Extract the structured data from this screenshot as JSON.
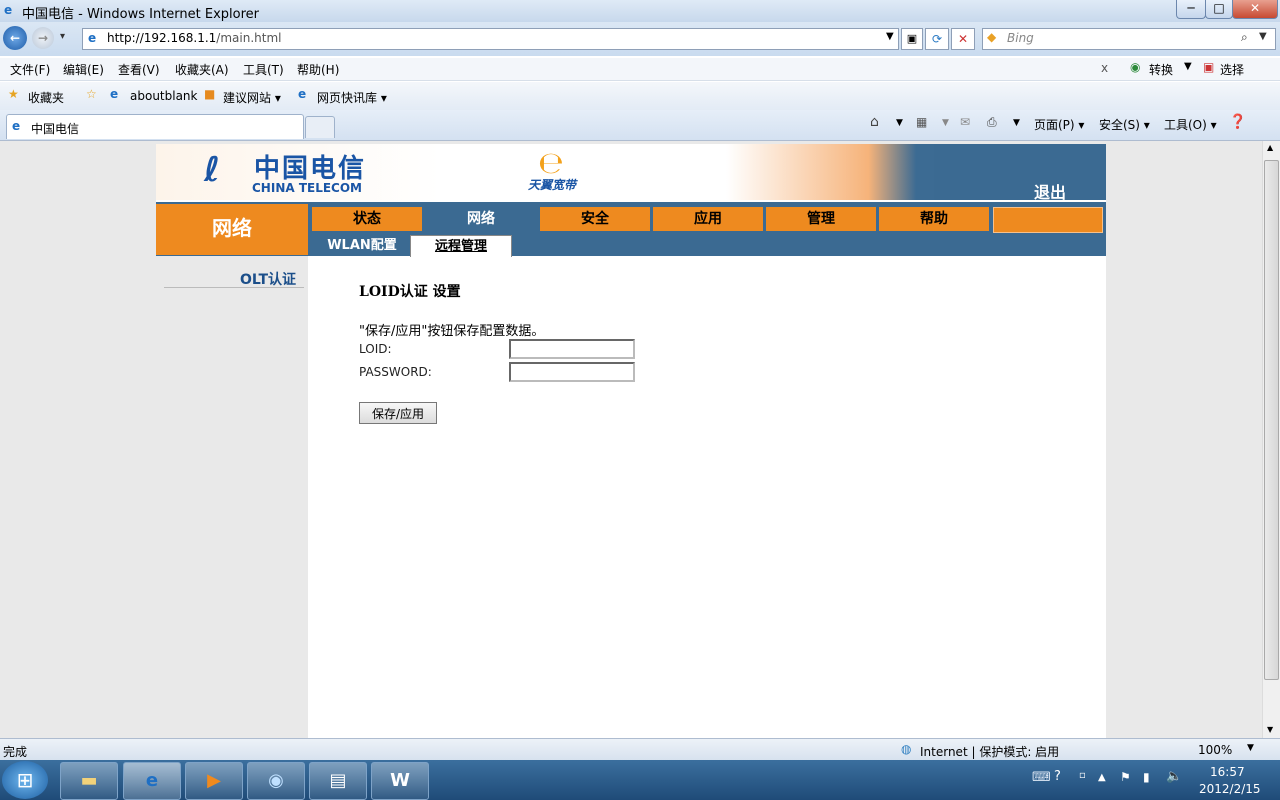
{
  "window": {
    "title": "中国电信 - Windows Internet Explorer",
    "minimize": "─",
    "maximize": "□",
    "close": "✕"
  },
  "address_bar": {
    "url_host": "http://192.168.1.1",
    "url_path": "/main.html"
  },
  "search": {
    "placeholder": "Bing"
  },
  "menu": [
    "文件(F)",
    "编辑(E)",
    "查看(V)",
    "收藏夹(A)",
    "工具(T)",
    "帮助(H)"
  ],
  "menu_right": {
    "convert": "转换",
    "select": "选择"
  },
  "favorites": {
    "favorites_label": "收藏夹",
    "items": [
      "aboutblank",
      "建议网站 ▾",
      "网页快讯库 ▾"
    ]
  },
  "tab": {
    "title": "中国电信"
  },
  "command_bar": {
    "page": "页面(P) ▾",
    "safety": "安全(S) ▾",
    "tools": "工具(O) ▾"
  },
  "router": {
    "logo_cn": "中国电信",
    "logo_en": "CHINA TELECOM",
    "tianyi": "天翼宽带",
    "logout": "退出",
    "section": "网络",
    "tabs": [
      "状态",
      "网络",
      "安全",
      "应用",
      "管理",
      "帮助"
    ],
    "subtabs": [
      "WLAN配置",
      "远程管理"
    ],
    "sidebar_item": "OLT认证",
    "main_title": "LOID认证 设置",
    "hint": "\"保存/应用\"按钮保存配置数据。",
    "loid_label": "LOID:",
    "password_label": "PASSWORD:",
    "loid_value": "",
    "password_value": "",
    "save_button": "保存/应用"
  },
  "status_bar": {
    "left": "完成",
    "zone": "Internet | 保护模式: 启用",
    "zoom": "100%"
  },
  "taskbar": {
    "time": "16:57",
    "date": "2012/2/15"
  },
  "colors": {
    "orange": "#ee8a1f",
    "navy": "#3b6a92",
    "brand_blue": "#1a55a5"
  }
}
